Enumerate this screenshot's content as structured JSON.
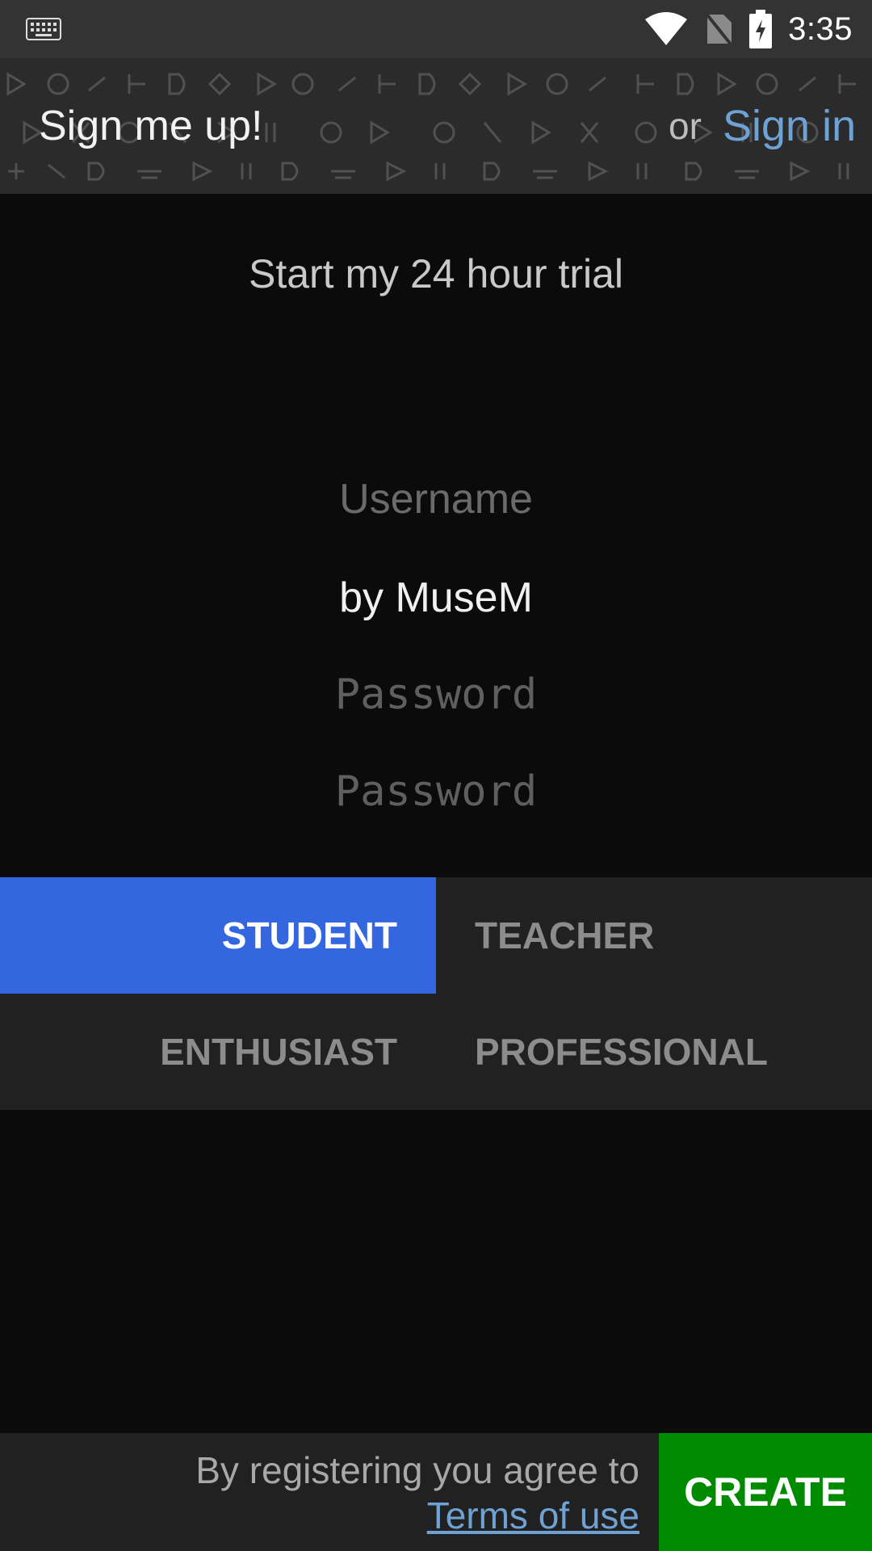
{
  "status_bar": {
    "time": "3:35",
    "icons": [
      "keyboard-icon",
      "wifi-icon",
      "no-sim-icon",
      "battery-charging-icon"
    ]
  },
  "header": {
    "title": "Sign me up!",
    "or_text": "or",
    "signin_label": "Sign in"
  },
  "form": {
    "heading": "Start my 24 hour trial",
    "username_placeholder": "Username",
    "byline_value": "by MuseM",
    "password_placeholder": "Password",
    "confirm_password_placeholder": "Password"
  },
  "roles": {
    "items": [
      {
        "label": "STUDENT",
        "selected": true
      },
      {
        "label": "TEACHER",
        "selected": false
      },
      {
        "label": "ENTHUSIAST",
        "selected": false
      },
      {
        "label": "PROFESSIONAL",
        "selected": false
      }
    ]
  },
  "footer": {
    "agree_text": "By registering you agree to",
    "terms_label": "Terms of use",
    "create_label": "CREATE"
  },
  "colors": {
    "accent_blue": "#3466e0",
    "link_blue": "#6fa2d4",
    "create_green": "#008a00"
  }
}
